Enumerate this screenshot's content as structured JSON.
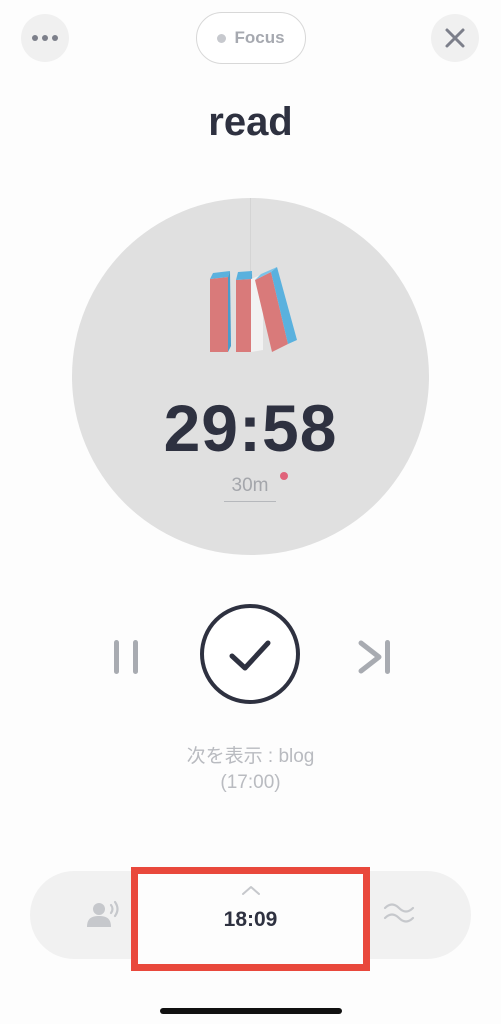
{
  "header": {
    "mode_label": "Focus",
    "more_icon": "more-dots-icon",
    "close_icon": "close-icon"
  },
  "task": {
    "title": "read",
    "icon": "books-icon"
  },
  "timer": {
    "remaining": "29:58",
    "duration": "30m"
  },
  "controls": {
    "pause_icon": "pause-icon",
    "complete_icon": "check-icon",
    "skip_icon": "skip-next-icon"
  },
  "next": {
    "label": "次を表示 : blog",
    "time": "(17:00)"
  },
  "bottom_bar": {
    "clock": "18:09",
    "left_icon": "voice-icon",
    "right_icon": "sound-wave-icon"
  },
  "colors": {
    "dark": "#2e3140",
    "highlight": "#e9483c",
    "dial": "#e0e0e0",
    "book_red": "#d97a7a",
    "book_blue": "#5ab1de",
    "notify_dot": "#e0637a"
  }
}
